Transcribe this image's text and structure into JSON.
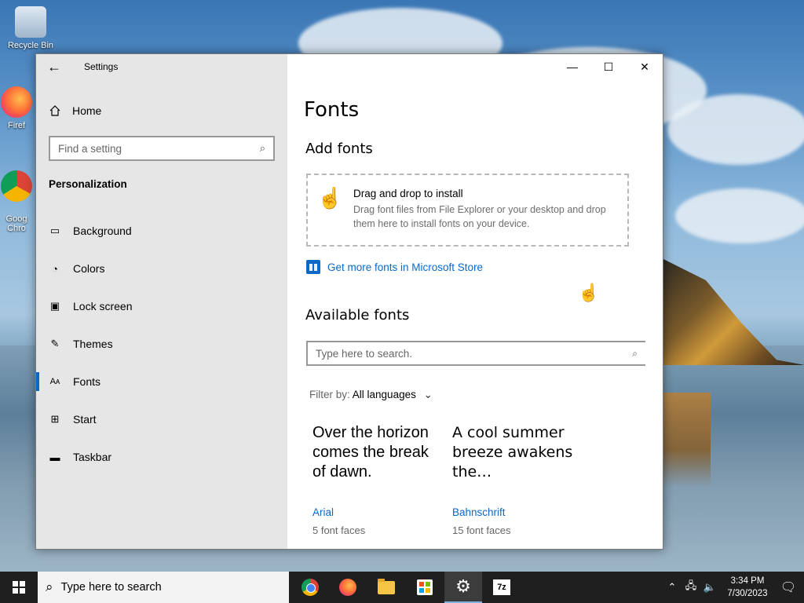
{
  "desktop": {
    "icons": [
      {
        "label": "Recycle Bin"
      },
      {
        "label": "Firef"
      },
      {
        "label": "Goog\nChro"
      }
    ]
  },
  "window": {
    "title": "Settings",
    "back_glyph": "←",
    "minimize_glyph": "—",
    "maximize_glyph": "☐",
    "close_glyph": "✕"
  },
  "sidebar": {
    "home_label": "Home",
    "search_placeholder": "Find a setting",
    "section_title": "Personalization",
    "items": [
      {
        "label": "Background",
        "icon": "picture-icon",
        "glyph": "▭"
      },
      {
        "label": "Colors",
        "icon": "palette-icon",
        "glyph": "◔"
      },
      {
        "label": "Lock screen",
        "icon": "lock-screen-icon",
        "glyph": "▣"
      },
      {
        "label": "Themes",
        "icon": "themes-icon",
        "glyph": "✎"
      },
      {
        "label": "Fonts",
        "icon": "fonts-icon",
        "glyph": "Aᴀ",
        "selected": true
      },
      {
        "label": "Start",
        "icon": "start-icon",
        "glyph": "⊞"
      },
      {
        "label": "Taskbar",
        "icon": "taskbar-icon",
        "glyph": "▬"
      }
    ]
  },
  "main": {
    "page_title": "Fonts",
    "add_fonts_heading": "Add fonts",
    "drop_title": "Drag and drop to install",
    "drop_description": "Drag font files from File Explorer or your desktop and drop them here to install fonts on your device.",
    "store_link": "Get more fonts in Microsoft Store",
    "available_heading": "Available fonts",
    "font_search_placeholder": "Type here to search.",
    "filter_label": "Filter by:",
    "filter_value": "All languages",
    "fonts": [
      {
        "sample": "Over the horizon comes the break of dawn.",
        "name": "Arial",
        "faces": "5 font faces"
      },
      {
        "sample": "A cool summer breeze awakens the…",
        "name": "Bahnschrift",
        "faces": "15 font faces"
      }
    ]
  },
  "taskbar": {
    "search_placeholder": "Type here to search",
    "apps": [
      {
        "name": "chrome"
      },
      {
        "name": "firefox"
      },
      {
        "name": "file-explorer"
      },
      {
        "name": "microsoft-store"
      },
      {
        "name": "settings",
        "active": true
      },
      {
        "name": "7-zip",
        "text": "7z"
      }
    ],
    "time": "3:34 PM",
    "date": "7/30/2023"
  },
  "colors": {
    "accent": "#0a68c9",
    "taskbar": "#1f1f1f",
    "sidebar": "#e6e6e6"
  }
}
